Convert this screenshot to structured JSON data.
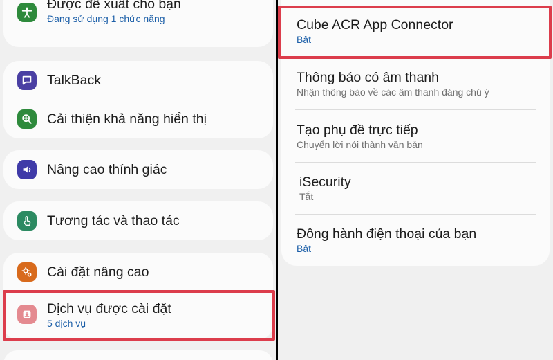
{
  "left": {
    "items": [
      {
        "title": "Được đề xuất cho bạn",
        "sub": "Đang sử dụng 1 chức năng",
        "icon": "accessibility-person-icon",
        "color": "#2e8a3c"
      },
      {
        "title": "TalkBack",
        "icon": "talkback-speech-icon",
        "color": "#4a3fa3"
      },
      {
        "title": "Cải thiện khả năng hiển thị",
        "icon": "magnify-plus-icon",
        "color": "#2e8a3c"
      },
      {
        "title": "Nâng cao thính giác",
        "icon": "hearing-volume-icon",
        "color": "#3f3aa8"
      },
      {
        "title": "Tương tác và thao tác",
        "icon": "touch-hand-icon",
        "color": "#2c8a62"
      },
      {
        "title": "Cài đặt nâng cao",
        "icon": "advanced-gears-icon",
        "color": "#d86a1c"
      },
      {
        "title": "Dịch vụ được cài đặt",
        "sub": "5 dịch vụ",
        "icon": "installed-download-icon",
        "color": "#e48a90"
      }
    ]
  },
  "right": {
    "items": [
      {
        "title": "Cube ACR App Connector",
        "sub": "Bật",
        "sub_style": "blue"
      },
      {
        "title": "Thông báo có âm thanh",
        "sub": "Nhận thông báo về các âm thanh đáng chú ý",
        "sub_style": "gray"
      },
      {
        "title": "Tạo phụ đề trực tiếp",
        "sub": "Chuyển lời nói thành văn bản",
        "sub_style": "gray"
      },
      {
        "title": "iSecurity",
        "sub": "Tắt",
        "sub_style": "gray"
      },
      {
        "title": "Đồng hành điện thoại của bạn",
        "sub": "Bật",
        "sub_style": "blue"
      }
    ]
  },
  "colors": {
    "highlight": "#dc3d4c",
    "link_blue": "#1c5fa8",
    "background": "#f0f0f0"
  }
}
